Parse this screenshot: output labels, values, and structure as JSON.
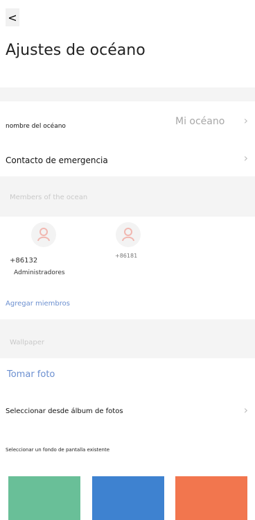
{
  "header": {
    "back_label": "<",
    "title": "Ajustes de océano"
  },
  "ocean_name": {
    "label": "nombre del océano",
    "value": "Mi océano"
  },
  "emergency_contact": {
    "label": "Contacto de emergencia"
  },
  "members_section": {
    "title": "Members of the ocean",
    "members": [
      {
        "phone": "+86132",
        "role": "Administradores"
      },
      {
        "phone": "+86181",
        "role": ""
      }
    ],
    "add_label": "Agregar miembros"
  },
  "wallpaper_section": {
    "title": "Wallpaper",
    "take_photo_label": "Tomar foto",
    "choose_album_label": "Seleccionar desde álbum de fotos",
    "existing_label": "Seleccionar un fondo de pantalla existente",
    "tiles": [
      "#69bf98",
      "#3e82d0",
      "#f2764e"
    ]
  },
  "colors": {
    "accent": "#6b8fd0",
    "band": "#f4f4f4",
    "avatar_icon": "#f1b7b0"
  }
}
